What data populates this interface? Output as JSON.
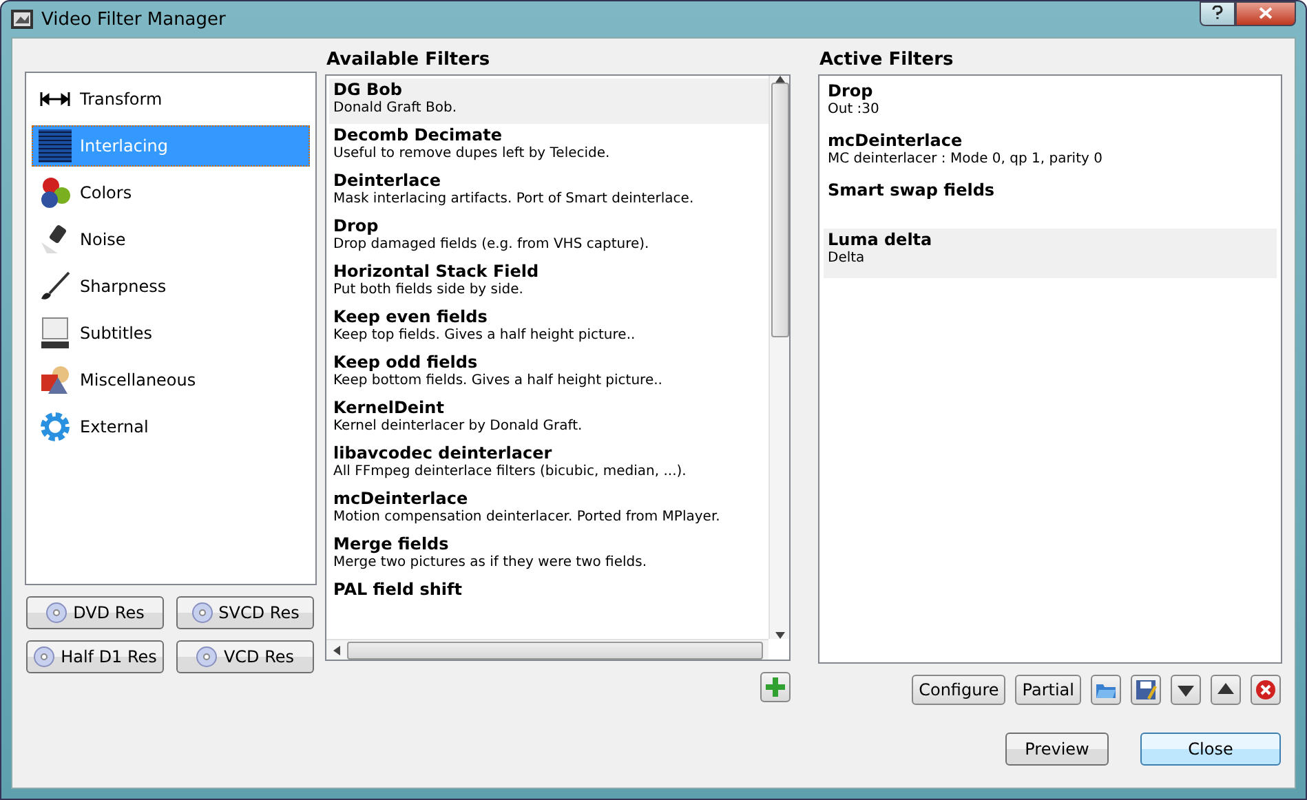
{
  "window": {
    "title": "Video Filter Manager"
  },
  "categories": [
    {
      "label": "Transform",
      "kind": "transform",
      "selected": false
    },
    {
      "label": "Interlacing",
      "kind": "interlacing",
      "selected": true
    },
    {
      "label": "Colors",
      "kind": "colors",
      "selected": false
    },
    {
      "label": "Noise",
      "kind": "noise",
      "selected": false
    },
    {
      "label": "Sharpness",
      "kind": "sharpness",
      "selected": false
    },
    {
      "label": "Subtitles",
      "kind": "subtitles",
      "selected": false
    },
    {
      "label": "Miscellaneous",
      "kind": "misc",
      "selected": false
    },
    {
      "label": "External",
      "kind": "external",
      "selected": false
    }
  ],
  "resolution_buttons": [
    "DVD Res",
    "SVCD Res",
    "Half D1 Res",
    "VCD Res"
  ],
  "available_filters": {
    "title": "Available Filters",
    "items": [
      {
        "name": "DG Bob",
        "description": "Donald Graft Bob.",
        "selected": true
      },
      {
        "name": "Decomb Decimate",
        "description": "Useful to remove dupes left by Telecide.",
        "selected": false
      },
      {
        "name": "Deinterlace",
        "description": "Mask interlacing artifacts. Port of Smart deinterlace.",
        "selected": false
      },
      {
        "name": "Drop",
        "description": "Drop damaged fields (e.g. from VHS capture).",
        "selected": false
      },
      {
        "name": "Horizontal Stack Field",
        "description": "Put both fields side by side.",
        "selected": false
      },
      {
        "name": "Keep even fields",
        "description": "Keep top fields. Gives a half height picture..",
        "selected": false
      },
      {
        "name": "Keep odd fields",
        "description": "Keep bottom fields. Gives a half height picture..",
        "selected": false
      },
      {
        "name": "KernelDeint",
        "description": "Kernel deinterlacer by Donald Graft.",
        "selected": false
      },
      {
        "name": "libavcodec deinterlacer",
        "description": "All FFmpeg deinterlace filters (bicubic, median, ...).",
        "selected": false
      },
      {
        "name": "mcDeinterlace",
        "description": "Motion compensation deinterlacer. Ported from MPlayer.",
        "selected": false
      },
      {
        "name": "Merge fields",
        "description": "Merge two pictures as if they were two fields.",
        "selected": false
      },
      {
        "name": "PAL field shift",
        "selected": false
      }
    ]
  },
  "active_filters": {
    "title": "Active Filters",
    "items": [
      {
        "name": "Drop",
        "description": "Out :30",
        "selected": false
      },
      {
        "name": "mcDeinterlace",
        "description": "MC deinterlacer : Mode 0, qp 1, parity 0",
        "selected": false
      },
      {
        "name": "Smart swap fields",
        "selected": false
      },
      {
        "name": "Luma delta",
        "description": "Delta",
        "selected": true
      }
    ]
  },
  "filter_buttons": [
    "Configure",
    "Partial"
  ],
  "buttons": [
    "Preview",
    "Close"
  ]
}
